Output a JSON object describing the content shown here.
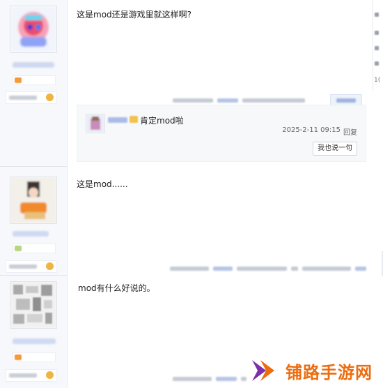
{
  "posts": [
    {
      "content": "这是mod还是游戏里就这样啊?",
      "comments": [
        {
          "text": "肯定mod啦",
          "time": "2025-2-11 09:15",
          "reply_label": "回复"
        }
      ],
      "say_button": "我也说一句"
    },
    {
      "content": "这是mod......"
    },
    {
      "content": "mod有什么好说的。"
    }
  ],
  "right_edge": {
    "text": "1("
  },
  "watermark": {
    "text": "铺路手游网"
  },
  "colors": {
    "sidebar_bg": "#f6f8fb",
    "subbox_bg": "#f7f8fa",
    "link_blue": "#3b6cc7",
    "watermark_orange": "#ec6d0f",
    "watermark_purple": "#7b2fa8"
  }
}
